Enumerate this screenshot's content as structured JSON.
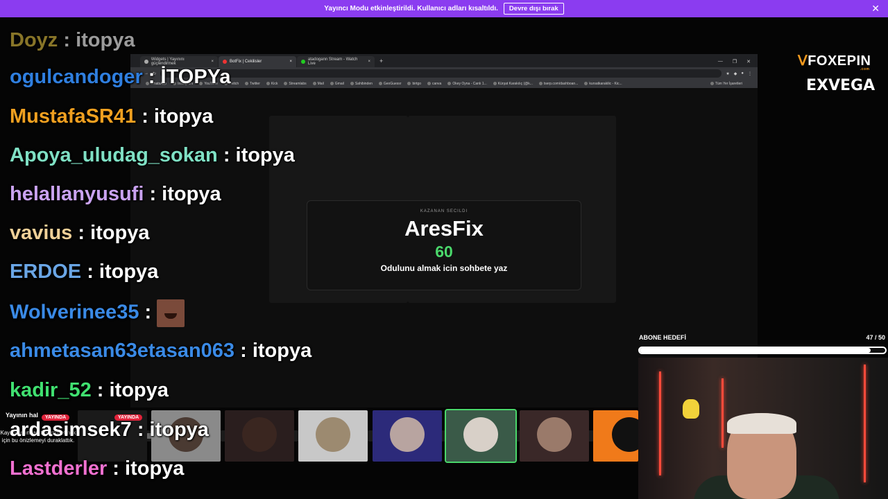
{
  "banner": {
    "message": "Yayıncı Modu etkinleştirildi. Kullanıcı adları kısaltıldı.",
    "button": "Devre dışı bırak",
    "close": "✕"
  },
  "browser": {
    "tabs": [
      {
        "title": "Widgets | Yayınını güçlendirmek"
      },
      {
        "title": "BotFix | Cekilisler"
      },
      {
        "title": "atadogann Stream - Watch Live"
      }
    ],
    "new_tab": "+",
    "bookmarks": [
      "WhatsApp",
      "Instagram",
      "YouTube",
      "Twitch",
      "Twitter",
      "Kick",
      "Streamlabs",
      "Mail",
      "Gmail",
      "Sahibinden",
      "GeoGuessr",
      "birtgo",
      "canva",
      "Okey Oyna - Canlı 1...",
      "Kürşat Karakılıç (@k...",
      "tserp.com/dashboan...",
      "kursatkarakilic - Kic..."
    ],
    "bookmarks_more": "Tüm Yer İşaretleri",
    "winner": {
      "heading": "KAZANAN SECILDI",
      "name": "AresFix",
      "number": "60",
      "instruction": "Odulunu almak icin sohbete yaz"
    }
  },
  "chat": [
    {
      "user": "Doyz",
      "text": ": itopya",
      "color": "#e0c040"
    },
    {
      "user": "ogulcandoger",
      "text": ": İTOPYa",
      "color": "#2f7fe0"
    },
    {
      "user": "MustafaSR41",
      "text": ": itopya",
      "color": "#f0a020"
    },
    {
      "user": "Apoya_uludag_sokan",
      "text": ": itopya",
      "color": "#7fe0c4"
    },
    {
      "user": "helallanyusufi",
      "text": ": itopya",
      "color": "#c9a2f0"
    },
    {
      "user": "vavius",
      "text": ": itopya",
      "color": "#f0d098"
    },
    {
      "user": "ERDOE",
      "text": ": itopya",
      "color": "#6aa6e6"
    },
    {
      "user": "Wolverinee35",
      "text": ":",
      "color": "#3a8ae6",
      "emote": true
    },
    {
      "user": "ahmetasan63etasan063",
      "text": ": itopya",
      "color": "#3a8ae6"
    },
    {
      "user": "kadir_52",
      "text": ": itopya",
      "color": "#40e070"
    },
    {
      "user": "ardasimsek7",
      "text": ": itopya",
      "color": "#ffffff"
    },
    {
      "user": "Lastderler",
      "text": ": itopya",
      "color": "#f070d0"
    }
  ],
  "strip": {
    "live_label": "YAYINDA",
    "paused_title": "Yayının hal",
    "paused_text": "Kaynaklarından tasarruf etmek için bu önizlemeyi duraklattık."
  },
  "overlay": {
    "brand1": "FOXEPIN",
    "brand1_sub": ".com",
    "brand2": "EXVEGA",
    "goal_label": "ABONE HEDEFİ",
    "goal_count": "47 / 50",
    "goal_fraction": 0.94
  },
  "colors": {
    "banner": "#8b3cf0",
    "accent_green": "#4ad86b",
    "live_red": "#e0223a"
  }
}
